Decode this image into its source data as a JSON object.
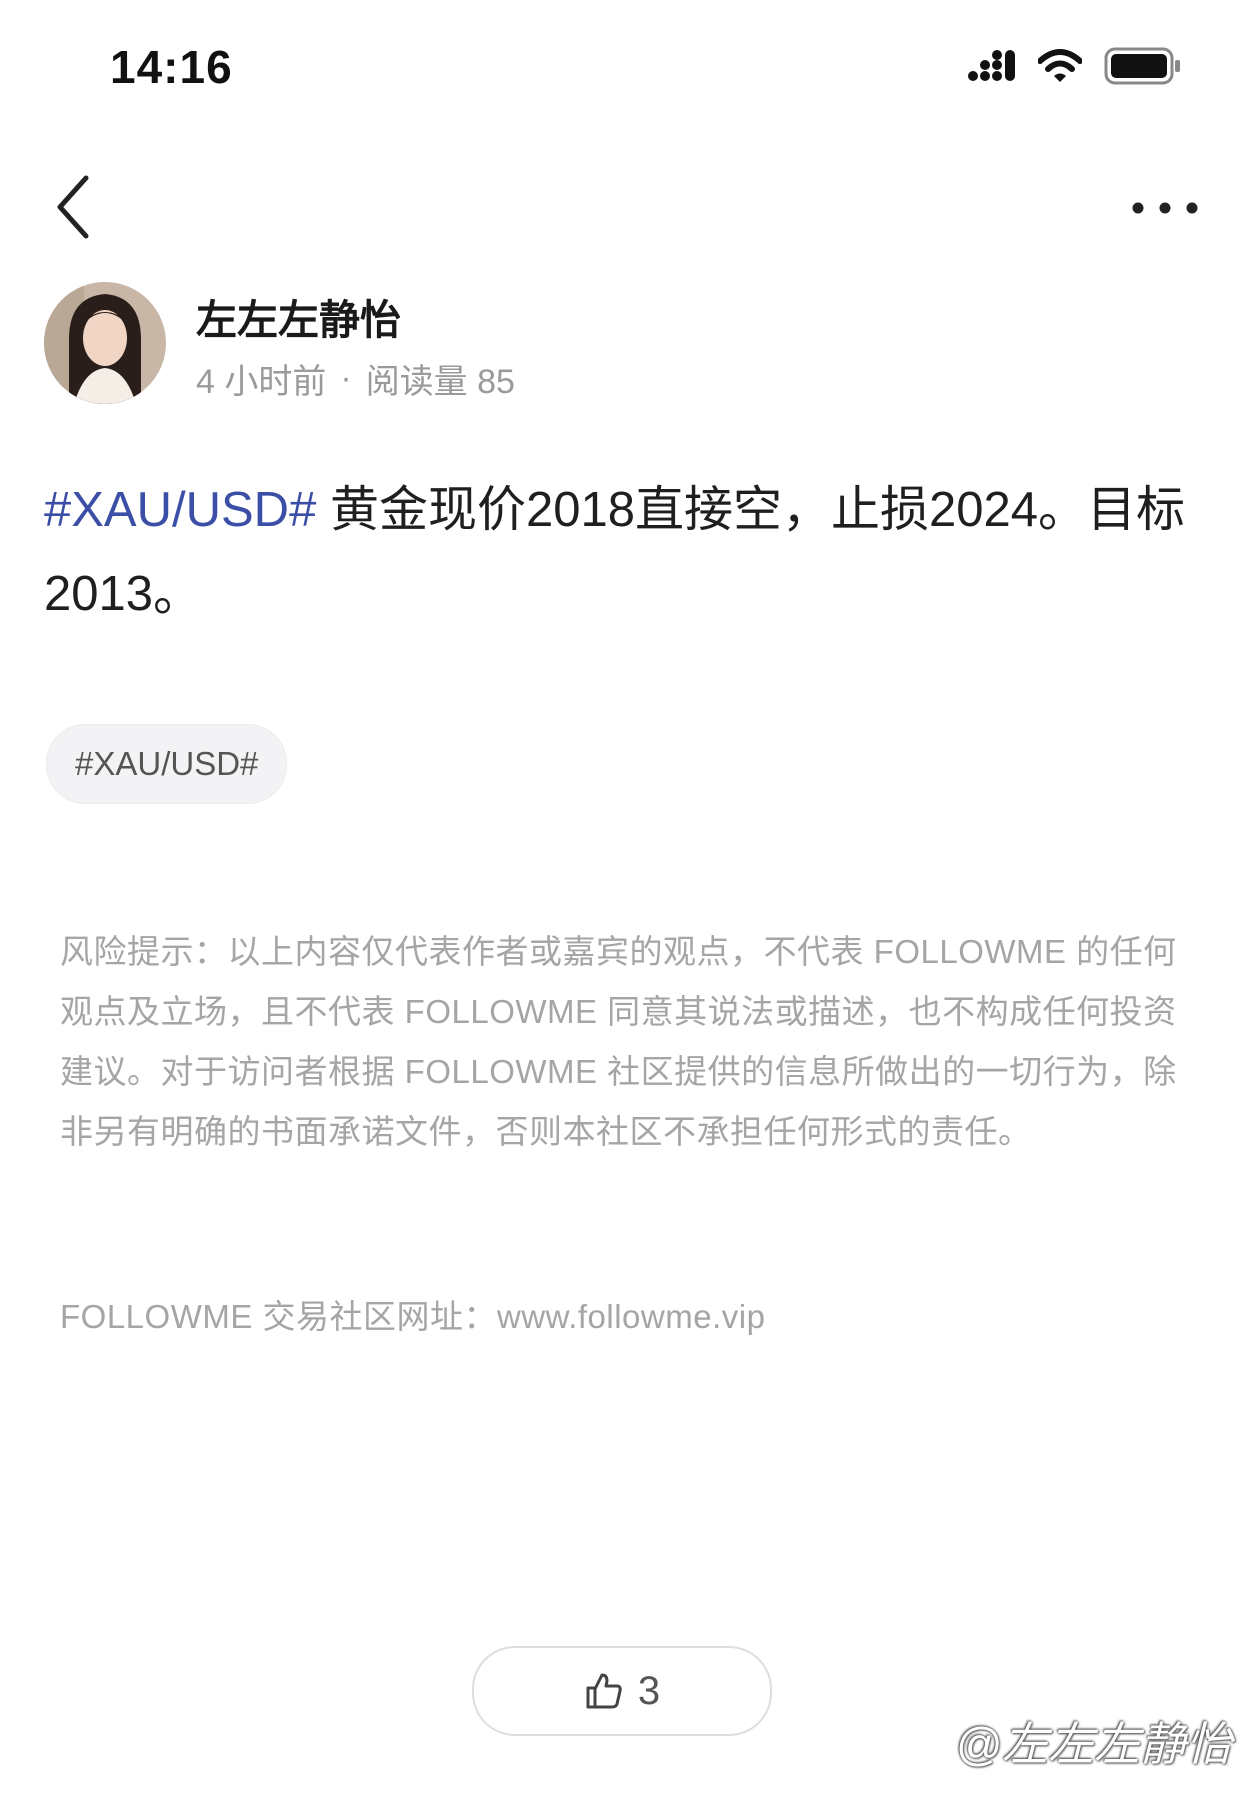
{
  "status_bar": {
    "time": "14:16"
  },
  "author": {
    "name": "左左左静怡",
    "posted": "4 小时前",
    "separator": "·",
    "views": "阅读量 85"
  },
  "post": {
    "hashtag": "#XAU/USD#",
    "text": " 黄金现价2018直接空，止损2024。目标2013。"
  },
  "tag_chip": "#XAU/USD#",
  "disclaimer": "风险提示：以上内容仅代表作者或嘉宾的观点，不代表 FOLLOWME 的任何观点及立场，且不代表 FOLLOWME 同意其说法或描述，也不构成任何投资建议。对于访问者根据 FOLLOWME 社区提供的信息所做出的一切行为，除非另有明确的书面承诺文件，否则本社区不承担任何形式的责任。",
  "site_line": "FOLLOWME 交易社区网址：www.followme.vip",
  "like": {
    "count": "3"
  },
  "watermark": "@左左左静怡",
  "colors": {
    "hashtag": "#3b4fa6",
    "muted": "#a5a5a5",
    "chip_bg": "#f3f3f5"
  },
  "icons": [
    "signal-icon",
    "wifi-icon",
    "battery-icon",
    "back-chevron-icon",
    "more-icon",
    "thumbs-up-icon",
    "weibo-logo-icon"
  ]
}
